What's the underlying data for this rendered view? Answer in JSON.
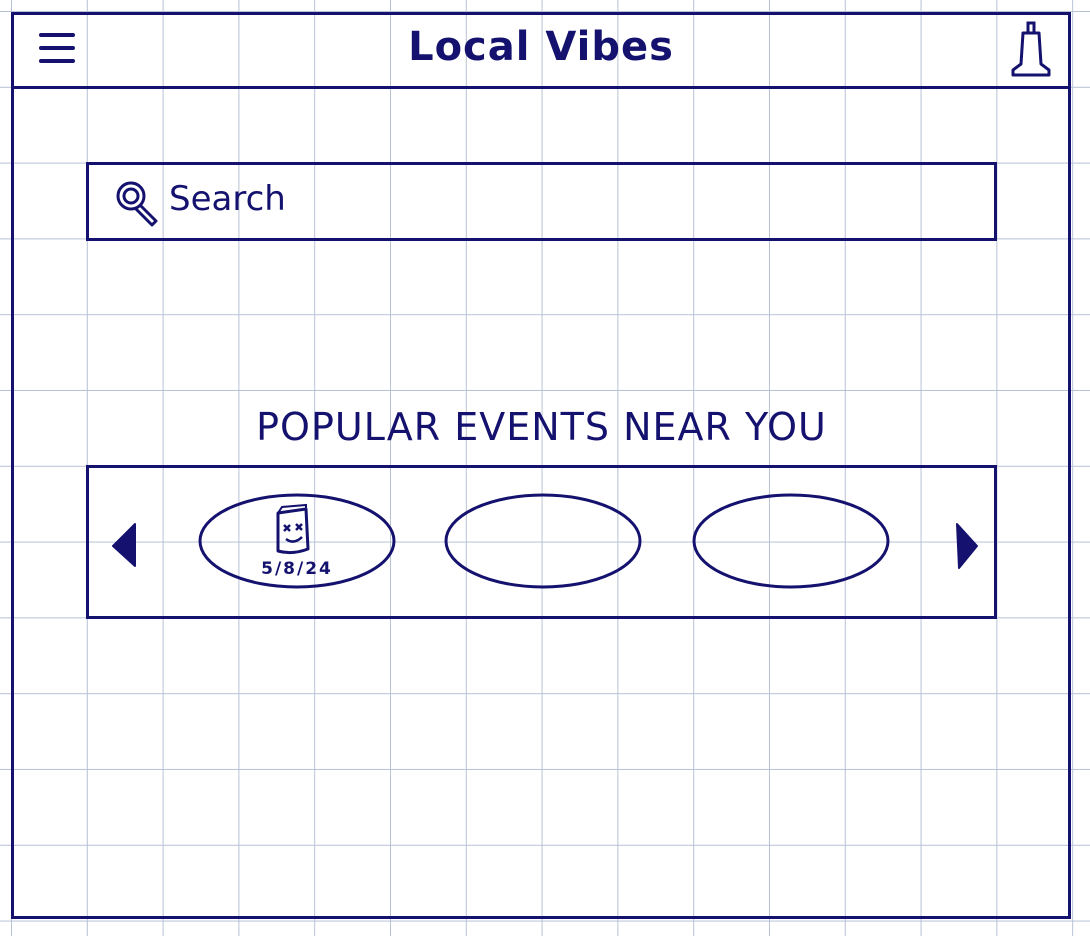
{
  "colors": {
    "ink": "#14126e",
    "grid": "#b7c2d6",
    "paper": "#ffffff"
  },
  "header": {
    "title": "Local Vibes",
    "menu_icon": "hamburger-menu-icon",
    "notification_icon": "bell-icon"
  },
  "search": {
    "placeholder": "Search",
    "icon": "search-icon"
  },
  "events": {
    "section_title": "POPULAR EVENTS NEAR YOU",
    "prev_icon": "triangle-left-icon",
    "next_icon": "triangle-right-icon",
    "cards": [
      {
        "date": "5/8/24",
        "thumbnail_icon": "jar-icon"
      },
      {
        "date": ""
      },
      {
        "date": ""
      }
    ]
  }
}
